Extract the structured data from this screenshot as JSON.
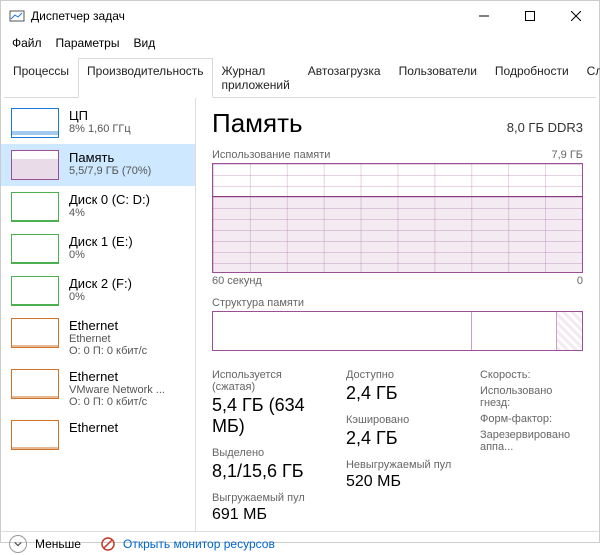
{
  "window": {
    "title": "Диспетчер задач"
  },
  "menu": {
    "file": "Файл",
    "options": "Параметры",
    "view": "Вид"
  },
  "tabs": {
    "processes": "Процессы",
    "performance": "Производительность",
    "app_history": "Журнал приложений",
    "startup": "Автозагрузка",
    "users": "Пользователи",
    "details": "Подробности",
    "services": "Службы"
  },
  "sidebar": {
    "items": [
      {
        "title": "ЦП",
        "line1": "8% 1,60 ГГц",
        "color": "#1a78d6"
      },
      {
        "title": "Память",
        "line1": "5,5/7,9 ГБ (70%)",
        "color": "#9b4f96",
        "selected": true
      },
      {
        "title": "Диск 0 (C: D:)",
        "line1": "4%",
        "color": "#4caf50"
      },
      {
        "title": "Диск 1 (E:)",
        "line1": "0%",
        "color": "#4caf50"
      },
      {
        "title": "Диск 2 (F:)",
        "line1": "0%",
        "color": "#4caf50"
      },
      {
        "title": "Ethernet",
        "line1": "Ethernet",
        "line2": "О: 0 П: 0 кбит/с",
        "color": "#d0742c"
      },
      {
        "title": "Ethernet",
        "line1": "VMware Network ...",
        "line2": "О: 0 П: 0 кбит/с",
        "color": "#d0742c"
      },
      {
        "title": "Ethernet",
        "line1": "",
        "color": "#d0742c"
      }
    ]
  },
  "main": {
    "title": "Память",
    "subtitle": "8,0 ГБ DDR3",
    "usage_label": "Использование памяти",
    "usage_max": "7,9 ГБ",
    "x_left": "60 секунд",
    "x_right": "0",
    "comp_label": "Структура памяти",
    "stats": {
      "in_use_label": "Используется (сжатая)",
      "in_use": "5,4 ГБ (634 МБ)",
      "committed_label": "Выделено",
      "committed": "8,1/15,6 ГБ",
      "paged_label": "Выгружаемый пул",
      "paged": "691 МБ",
      "avail_label": "Доступно",
      "avail": "2,4 ГБ",
      "cached_label": "Кэшировано",
      "cached": "2,4 ГБ",
      "nonpaged_label": "Невыгружаемый пул",
      "nonpaged": "520 МБ",
      "speed_label": "Скорость:",
      "slots_label": "Использовано гнезд:",
      "form_label": "Форм-фактор:",
      "reserved_label": "Зарезервировано аппа..."
    }
  },
  "bottom": {
    "fewer": "Меньше",
    "resmon": "Открыть монитор ресурсов"
  },
  "chart_data": {
    "type": "area",
    "title": "Использование памяти",
    "ylim": [
      0,
      7.9
    ],
    "yunit": "ГБ",
    "xlabel": "60 секунд → 0",
    "series": [
      {
        "name": "Память",
        "values": [
          5.5,
          5.5,
          5.5,
          5.5,
          5.5,
          5.5,
          5.5,
          5.5,
          5.5,
          5.5,
          5.5,
          5.5,
          5.5,
          5.5,
          5.5,
          5.5,
          5.5,
          5.5,
          5.5,
          5.5
        ]
      }
    ],
    "fill_percent": 70
  }
}
